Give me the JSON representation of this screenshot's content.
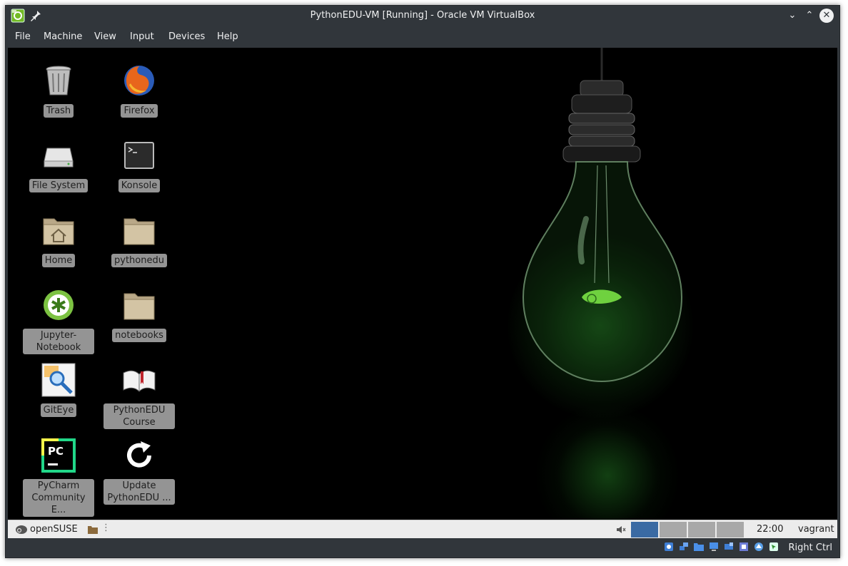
{
  "window": {
    "title": "PythonEDU-VM [Running] - Oracle VM VirtualBox",
    "minimize_glyph": "⌄",
    "maximize_glyph": "⌃",
    "close_glyph": "✕"
  },
  "menu": [
    "File",
    "Machine",
    "View",
    "Input",
    "Devices",
    "Help"
  ],
  "desktop": {
    "icons": [
      {
        "label": "Trash",
        "icon": "trash-icon"
      },
      {
        "label": "Firefox",
        "icon": "firefox-icon"
      },
      {
        "label": "File System",
        "icon": "hard-drive-icon"
      },
      {
        "label": "Konsole",
        "icon": "terminal-icon"
      },
      {
        "label": "Home",
        "icon": "home-folder-icon"
      },
      {
        "label": "pythonedu",
        "icon": "folder-icon"
      },
      {
        "label": "Jupyter-Notebook",
        "icon": "jupyter-icon"
      },
      {
        "label": "notebooks",
        "icon": "folder-icon"
      },
      {
        "label": "GitEye",
        "icon": "giteye-icon"
      },
      {
        "label": "PythonEDU Course",
        "icon": "book-icon"
      },
      {
        "label": "PyCharm Community E...",
        "icon": "pycharm-icon"
      },
      {
        "label": "Update PythonEDU ...",
        "icon": "refresh-icon"
      }
    ]
  },
  "taskbar": {
    "start_label": "openSUSE",
    "clock": "22:00",
    "user": "vagrant",
    "active_desktop": 1,
    "desktop_count": 4
  },
  "statusbar": {
    "host_key": "Right Ctrl"
  },
  "colors": {
    "frame": "#31363b",
    "pager_active": "#3a6aa3",
    "pager_inactive": "#a8a8a8",
    "glow": "#2f9a2f"
  }
}
